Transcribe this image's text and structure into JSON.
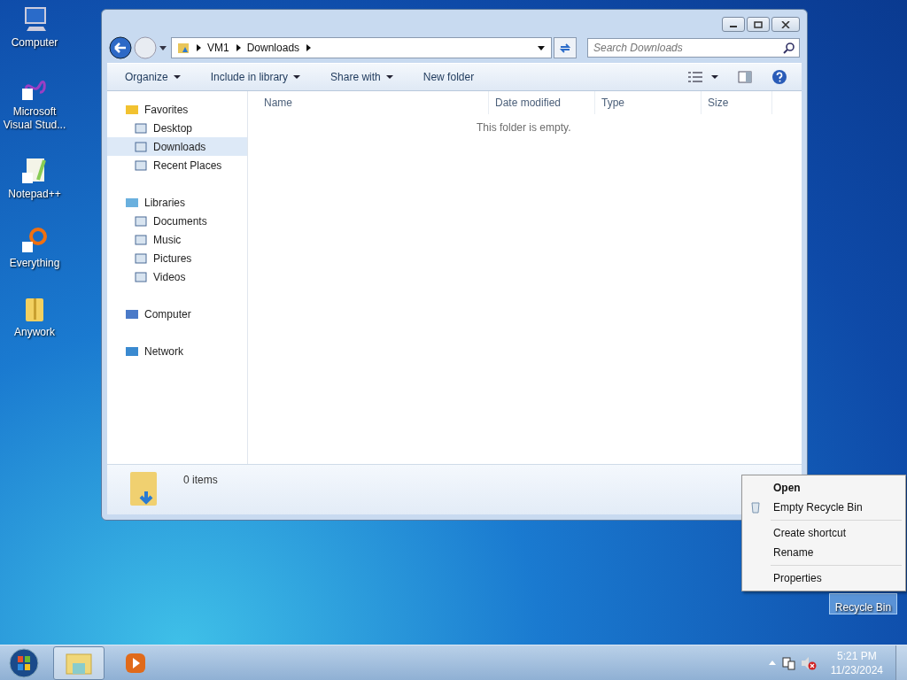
{
  "desktop_icons": [
    {
      "label": "Computer",
      "selected": false
    },
    {
      "label": "Microsoft Visual Stud...",
      "selected": false
    },
    {
      "label": "Notepad++",
      "selected": false
    },
    {
      "label": "Everything",
      "selected": false
    },
    {
      "label": "Anywork",
      "selected": false
    }
  ],
  "recycle_bin": {
    "label": "Recycle Bin",
    "selected": true
  },
  "window": {
    "breadcrumb": [
      "VM1",
      "Downloads"
    ],
    "search": {
      "placeholder": "Search Downloads"
    },
    "toolbar": [
      {
        "label": "Organize",
        "dropdown": true
      },
      {
        "label": "Include in library",
        "dropdown": true
      },
      {
        "label": "Share with",
        "dropdown": true
      },
      {
        "label": "New folder",
        "dropdown": false
      }
    ],
    "nav_pane": [
      {
        "label": "Favorites",
        "selected": false,
        "children": [
          {
            "label": "Desktop",
            "selected": false
          },
          {
            "label": "Downloads",
            "selected": true
          },
          {
            "label": "Recent Places",
            "selected": false
          }
        ]
      },
      {
        "label": "Libraries",
        "selected": false,
        "children": [
          {
            "label": "Documents",
            "selected": false
          },
          {
            "label": "Music",
            "selected": false
          },
          {
            "label": "Pictures",
            "selected": false
          },
          {
            "label": "Videos",
            "selected": false
          }
        ]
      },
      {
        "label": "Computer",
        "selected": false
      },
      {
        "label": "Network",
        "selected": false
      }
    ],
    "columns": [
      "Name",
      "Date modified",
      "Type",
      "Size"
    ],
    "empty_message": "This folder is empty.",
    "status": "0 items"
  },
  "context_menu": {
    "groups": [
      [
        {
          "label": "Open",
          "default": true
        },
        {
          "label": "Empty Recycle Bin",
          "default": false
        }
      ],
      [
        {
          "label": "Create shortcut",
          "default": false
        },
        {
          "label": "Rename",
          "default": false
        }
      ],
      [
        {
          "label": "Properties",
          "default": false
        }
      ]
    ]
  },
  "taskbar": {
    "items": [
      {
        "kind": "explorer",
        "selected": true
      },
      {
        "kind": "media",
        "selected": false
      }
    ],
    "time": "5:21 PM",
    "date": "11/23/2024"
  }
}
